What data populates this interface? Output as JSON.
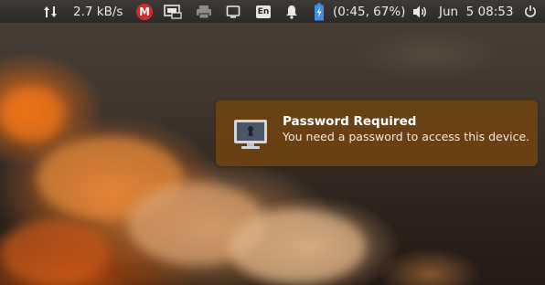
{
  "top_panel": {
    "network_speed": "2.7 kB/s",
    "mega_letter": "M",
    "keyboard_layout": "En",
    "battery_status": "(0:45, 67%)",
    "datetime": "Jun  5 08:53"
  },
  "notification": {
    "title": "Password Required",
    "body": "You need a password to access this device."
  },
  "colors": {
    "panel_bg": "#2c2a27",
    "notification_bg": "#6e4212",
    "mega_red": "#d9272e",
    "battery_blue": "#3b8fe6"
  },
  "icons": [
    "network-updown-icon",
    "mega-icon",
    "display-icon",
    "printer-icon",
    "screen-icon",
    "keyboard-layout-icon",
    "bell-icon",
    "battery-charging-icon",
    "volume-icon",
    "power-icon",
    "lock-monitor-icon"
  ]
}
